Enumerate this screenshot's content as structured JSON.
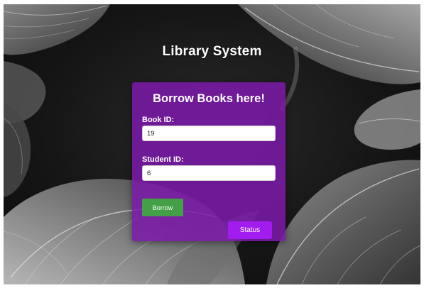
{
  "page": {
    "title": "Library System",
    "background": "dark-tropical-leaves"
  },
  "borrow_form": {
    "heading": "Borrow Books here!",
    "book_id": {
      "label": "Book ID:",
      "value": "19"
    },
    "student_id": {
      "label": "Student ID:",
      "value": "6"
    },
    "borrow_label": "Borrow",
    "status_label": "Status"
  },
  "colors": {
    "card": "#7b18aa",
    "borrow_button": "#43a047",
    "status_button": "#a21cf0",
    "title_text": "#ffffff"
  }
}
